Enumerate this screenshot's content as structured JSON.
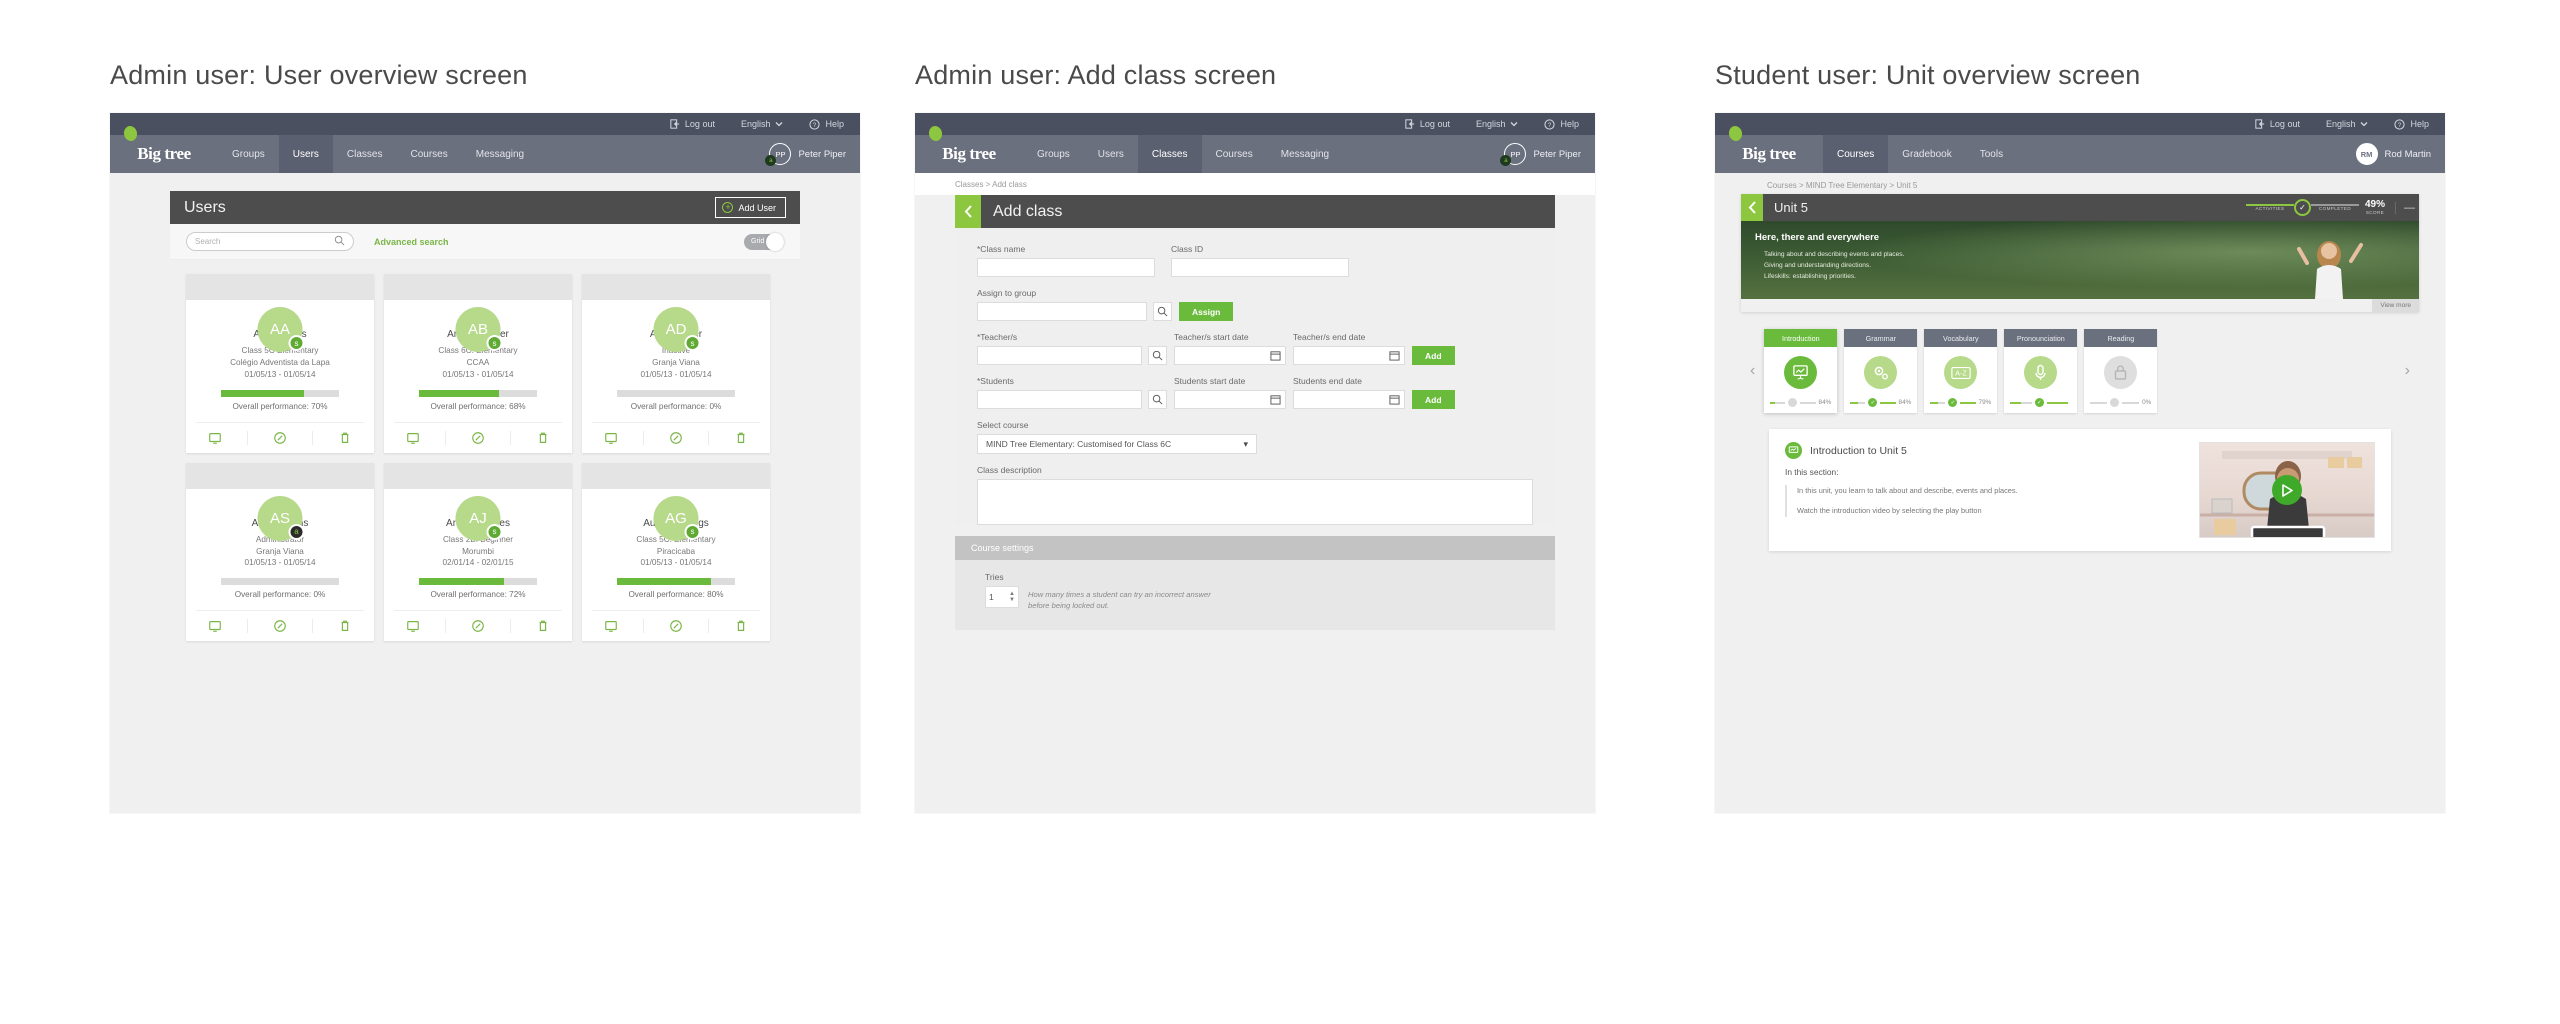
{
  "panels": [
    {
      "caption": "Admin user: User overview screen"
    },
    {
      "caption": "Admin user: Add class screen"
    },
    {
      "caption": "Student user: Unit overview screen"
    }
  ],
  "utilbar": {
    "logout": "Log out",
    "language": "English",
    "help": "Help",
    "caret": "⌄"
  },
  "admin_nav": {
    "brand": "Big tree",
    "items": [
      "Groups",
      "Users",
      "Classes",
      "Courses",
      "Messaging"
    ],
    "user": {
      "initials": "PP",
      "name": "Peter Piper",
      "badge": "a"
    }
  },
  "student_nav": {
    "brand": "Big tree",
    "items": [
      "Courses",
      "Gradebook",
      "Tools"
    ],
    "user": {
      "initials": "RM",
      "name": "Rod Martin"
    }
  },
  "users_screen": {
    "title": "Users",
    "add_button": "Add User",
    "search_placeholder": "Search",
    "advanced_search": "Advanced search",
    "toggle_label": "Grid",
    "cards": [
      {
        "initials": "AA",
        "badge": "s",
        "badge_type": "student",
        "name": "Amy Adams",
        "line1": "Class 5C Elementary",
        "line2": "Colégio Adventista da Lapa",
        "dates": "01/05/13 - 01/05/14",
        "performance": 70,
        "performance_label": "Overall performance: 70%"
      },
      {
        "initials": "AB",
        "badge": "s",
        "badge_type": "student",
        "name": "Amy Bollinger",
        "line1": "Class 6C: Elementary",
        "line2": "CCAA",
        "dates": "01/05/13 - 01/05/14",
        "performance": 68,
        "performance_label": "Overall performance: 68%"
      },
      {
        "initials": "AD",
        "badge": "s",
        "badge_type": "student",
        "name": "Amy Dexter",
        "line1": "Inactive",
        "line2": "Granja Viana",
        "dates": "01/05/13 - 01/05/14",
        "performance": 0,
        "performance_label": "Overall performance: 0%"
      },
      {
        "initials": "AS",
        "badge": "a",
        "badge_type": "admin",
        "name": "Ann Stevens",
        "line1": "Administrator",
        "line2": "Granja Viana",
        "dates": "01/05/13 - 01/05/14",
        "performance": 0,
        "performance_label": "Overall performance: 0%"
      },
      {
        "initials": "AJ",
        "badge": "s",
        "badge_type": "student",
        "name": "Annette Jones",
        "line1": "Class 2B: Beginner",
        "line2": "Morumbi",
        "dates": "02/01/14 - 02/01/15",
        "performance": 72,
        "performance_label": "Overall performance: 72%"
      },
      {
        "initials": "AG",
        "badge": "s",
        "badge_type": "student",
        "name": "Aurora Greggs",
        "line1": "Class 5C: Elementary",
        "line2": "Piracicaba",
        "dates": "01/05/13 - 01/05/14",
        "performance": 80,
        "performance_label": "Overall performance: 80%"
      }
    ]
  },
  "addclass_screen": {
    "breadcrumb": "Classes > Add class",
    "title": "Add class",
    "fields": {
      "class_name": "*Class name",
      "class_id": "Class ID",
      "assign_group": "Assign to group",
      "assign_button": "Assign",
      "teachers": "*Teacher/s",
      "teachers_start": "Teacher/s start date",
      "teachers_end": "Teacher/s end date",
      "teachers_add": "Add",
      "students": "*Students",
      "students_start": "Students start date",
      "students_end": "Students end date",
      "students_add": "Add",
      "select_course": "Select course",
      "selected_course": "MIND Tree Elementary: Customised for Class 6C",
      "class_description": "Class description"
    },
    "course_settings": {
      "header": "Course settings",
      "tries_label": "Tries",
      "tries_value": "1",
      "tries_hint": "How many times a student can try an incorrect answer before being locked out."
    }
  },
  "unit_screen": {
    "breadcrumb": "Courses > MIND Tree Elementary > Unit 5",
    "unit_title": "Unit 5",
    "progress": {
      "activities_label": "ACTIVITIES",
      "completed_label": "COMPLETED",
      "score_value": "49%",
      "score_label": "SCORE"
    },
    "hero": {
      "heading": "Here, there and everywhere",
      "lines": [
        "Talking about and describing events and places.",
        "Giving and understanding directions.",
        "Lifeskills: establishing priorities."
      ]
    },
    "view_more": "View more",
    "tabs": [
      {
        "label": "Introduction",
        "icon": "presentation-chart-icon",
        "percent": "84%",
        "progress": 30,
        "state": "active",
        "dot": "pending"
      },
      {
        "label": "Grammar",
        "icon": "gears-icon",
        "percent": "84%",
        "progress": 50,
        "state": "normal",
        "dot": "done"
      },
      {
        "label": "Vocabulary",
        "icon": "a-to-z-icon",
        "percent": "79%",
        "progress": 50,
        "state": "normal",
        "dot": "done"
      },
      {
        "label": "Pronounciation",
        "icon": "microphone-icon",
        "percent": "",
        "progress": 50,
        "state": "normal",
        "dot": "done"
      },
      {
        "label": "Reading",
        "icon": "lock-icon",
        "percent": "0%",
        "progress": 0,
        "state": "locked",
        "dot": "off"
      }
    ],
    "intro": {
      "title": "Introduction to Unit 5",
      "subtitle": "In this section:",
      "paragraphs": [
        "In this unit, you learn to talk about and describe, events and places.",
        "Watch the introduction video by selecting the play button"
      ]
    }
  },
  "colors": {
    "brand_green": "#8dc63f",
    "green_button": "#6aba3c",
    "nav_blue_grey": "#6b707e",
    "utilbar": "#4a5060",
    "dark_header": "#4d4d4d"
  }
}
